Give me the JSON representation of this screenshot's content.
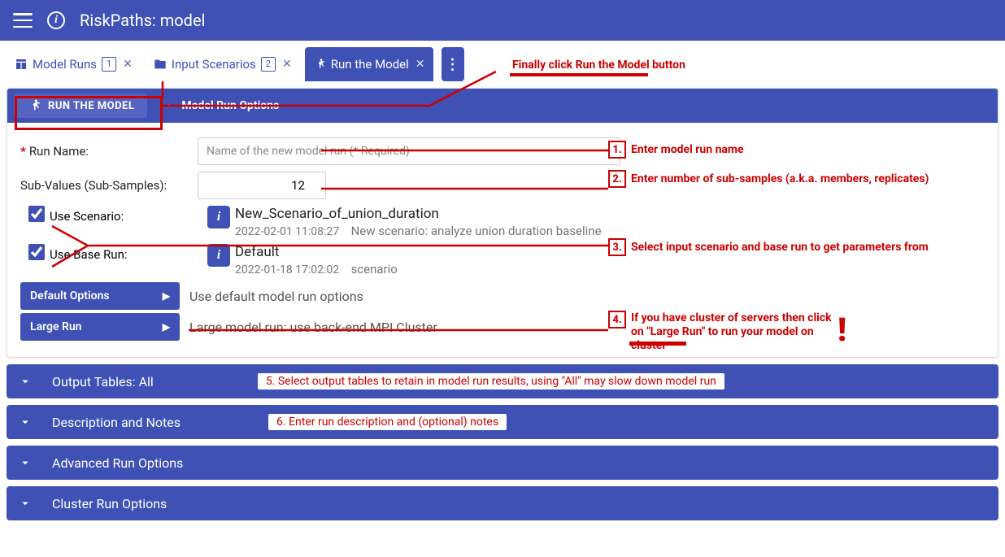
{
  "header": {
    "title": "RiskPaths: model"
  },
  "tabs": {
    "t0": {
      "label": "Model Runs",
      "badge": "1"
    },
    "t1": {
      "label": "Input Scenarios",
      "badge": "2"
    },
    "t2": {
      "label": "Run the Model"
    }
  },
  "actionbar": {
    "run_label": "RUN THE MODEL",
    "options_label": "Model Run Options"
  },
  "form": {
    "run_name_label": "Run Name:",
    "run_name_placeholder": "Name of the new model run (* Required)",
    "sub_values_label": "Sub-Values (Sub-Samples):",
    "sub_values_value": "12",
    "use_scenario_label": "Use Scenario:",
    "use_base_run_label": "Use Base Run:",
    "scenario": {
      "name": "New_Scenario_of_union_duration",
      "ts": "2022-02-01 11:08:27",
      "desc": "New scenario: analyze union duration baseline"
    },
    "base_run": {
      "name": "Default",
      "ts": "2022-01-18 17:02:02",
      "desc": "scenario"
    },
    "default_options_btn": "Default Options",
    "default_options_desc": "Use default model run options",
    "large_run_btn": "Large Run",
    "large_run_desc": "Large model run: use back-end MPI Cluster"
  },
  "accordions": {
    "output_tables": "Output Tables: All",
    "description": "Description and Notes",
    "advanced": "Advanced Run Options",
    "cluster": "Cluster Run Options"
  },
  "annotations": {
    "top": "Finally click Run the Model button",
    "a1n": "1.",
    "a1": "Enter model run name",
    "a2n": "2.",
    "a2": "Enter number of sub-samples (a.k.a. members, replicates)",
    "a3n": "3.",
    "a3": "Select input scenario and base run to get parameters from",
    "a4n": "4.",
    "a4": "If you have cluster of servers then click on \"Large Run\" to run your model on cluster",
    "a5": "5. Select output tables to retain in model run results, using \"All\" may slow down model run",
    "a6": "6. Enter run description and (optional) notes"
  }
}
